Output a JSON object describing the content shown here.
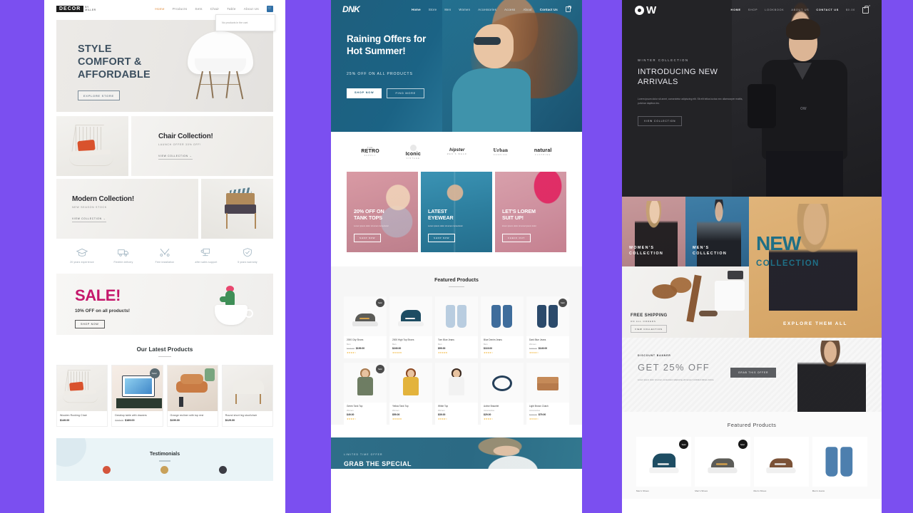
{
  "page": {
    "background_color": "#7b4ff0",
    "title": "Three e-commerce website mockups"
  },
  "site1": {
    "name": "DECOR",
    "logo": {
      "mark": "DECOR",
      "sub_line1": "BY",
      "sub_line2": "MILLER"
    },
    "nav": [
      {
        "label": "Home",
        "active": true
      },
      {
        "label": "Products",
        "active": false
      },
      {
        "label": "Sets",
        "active": false
      },
      {
        "label": "Chair",
        "active": false
      },
      {
        "label": "Table",
        "active": false
      },
      {
        "label": "About Us",
        "active": false
      }
    ],
    "cart_icon": "shopping-cart-icon",
    "cart_popup": "No products in the cart.",
    "hero": {
      "line1": "STYLE",
      "line2": "COMFORT &",
      "line3": "AFFORDABLE",
      "button": "EXPLORE STORE"
    },
    "collections": [
      {
        "title": "Chair Collection!",
        "sub": "LAUNCH OFFER 30% OFF!",
        "link": "VIEW COLLECTION  →"
      },
      {
        "title": "Modern Collection!",
        "sub": "NEW SEASON STOCK",
        "link": "VIEW COLLECTION  →"
      }
    ],
    "features": [
      {
        "icon": "graduation-cap-icon",
        "label": "20 years experience"
      },
      {
        "icon": "truck-icon",
        "label": "Flexible delivery"
      },
      {
        "icon": "tools-icon",
        "label": "Free installation"
      },
      {
        "icon": "support-icon",
        "label": "after sales support"
      },
      {
        "icon": "shield-check-icon",
        "label": "5 years warranty"
      }
    ],
    "sale": {
      "title": "SALE!",
      "sub": "10% OFF on all products!",
      "button": "SHOP NOW"
    },
    "latest": {
      "heading": "Our Latest Products",
      "products": [
        {
          "name": "Wooden Rocking Chair",
          "price": "$149.00",
          "old_price": "",
          "badge": ""
        },
        {
          "name": "Desktop table with drawers",
          "price": "$189.00",
          "old_price": "$349.00",
          "badge": "Sale!"
        },
        {
          "name": "Orange recliner with top rest",
          "price": "$199.00",
          "old_price": "",
          "badge": ""
        },
        {
          "name": "Round short leg stool/chair",
          "price": "$129.00",
          "old_price": "",
          "badge": ""
        }
      ]
    },
    "testimonials": {
      "heading": "Testimonials"
    }
  },
  "site2": {
    "name": "DNK",
    "nav": [
      {
        "label": "Home",
        "active": true
      },
      {
        "label": "Store",
        "active": false
      },
      {
        "label": "Men",
        "active": false
      },
      {
        "label": "Women",
        "active": false
      },
      {
        "label": "Accessories",
        "active": false
      },
      {
        "label": "Access",
        "active": false
      },
      {
        "label": "About",
        "active": false
      },
      {
        "label": "Contact Us",
        "active": true
      }
    ],
    "cart_icon": "shopping-bag-icon",
    "hero": {
      "line1": "Raining Offers for",
      "line2": "Hot Summer!",
      "sub": "25% OFF ON ALL PRODUCTS",
      "primary_button": "SHOP NOW",
      "secondary_button": "FIND MORE"
    },
    "brands": [
      {
        "top": "THE",
        "main": "RETRO",
        "bottom": "SUPPLY"
      },
      {
        "top": "",
        "main": "Iconic",
        "bottom": "VINTAGE"
      },
      {
        "top": "",
        "main": "hipster",
        "bottom": "MEN'S WEAR"
      },
      {
        "top": "",
        "main": "Urban",
        "bottom": "FASHION"
      },
      {
        "top": "",
        "main": "natural",
        "bottom": "CLOTHING"
      }
    ],
    "promos": [
      {
        "title": "20% OFF ON\nTANK TOPS",
        "desc": "Lorem ipsum dolor sit amet consectetur",
        "button": "SHOP NOW"
      },
      {
        "title": "LATEST\nEYEWEAR",
        "desc": "Lorem ipsum dolor sit amet consectetur",
        "button": "SHOP NOW"
      },
      {
        "title": "LET'S LOREM\nSUIT UP!",
        "desc": "lorem ipsum dolor sit amet ipsum dolor",
        "button": "CHECK OUT"
      }
    ],
    "featured": {
      "heading": "Featured Products",
      "row1": [
        {
          "name": "2000 City Shoes",
          "category": "Men",
          "price": "$199.00",
          "old_price": "$249.00",
          "stars": "★★★★☆",
          "badge": "Sale!",
          "glyph": "shoe"
        },
        {
          "name": "2000 High Top Shoes",
          "category": "Men",
          "price": "$249.00",
          "old_price": "",
          "stars": "★★★★★",
          "badge": "",
          "glyph": "shoe"
        },
        {
          "name": "Torn Blue Jeans",
          "category": "Men",
          "price": "$99.00",
          "old_price": "",
          "stars": "★★★★★",
          "badge": "",
          "glyph": "jeans"
        },
        {
          "name": "Blue Denim Jeans",
          "category": "Men",
          "price": "$119.00",
          "old_price": "",
          "stars": "★★★★☆",
          "badge": "",
          "glyph": "jeans"
        },
        {
          "name": "Dark Blue Jeans",
          "category": "Women",
          "price": "$149.00",
          "old_price": "$199.00",
          "stars": "★★★★☆",
          "badge": "Sale!",
          "glyph": "jeans"
        }
      ],
      "row2": [
        {
          "name": "Green Tank Top",
          "category": "Women",
          "price": "$49.00",
          "old_price": "",
          "stars": "★★★★☆",
          "badge": "Sale!",
          "glyph": "person"
        },
        {
          "name": "Yellow Tank Top",
          "category": "Women",
          "price": "$59.00",
          "old_price": "",
          "stars": "★★★★★",
          "badge": "",
          "glyph": "person"
        },
        {
          "name": "White Top",
          "category": "Women",
          "price": "$39.00",
          "old_price": "",
          "stars": "★★★★☆",
          "badge": "",
          "glyph": "person"
        },
        {
          "name": "Active Bracelet",
          "category": "Accessories",
          "price": "$29.00",
          "old_price": "",
          "stars": "★★★★☆",
          "badge": "",
          "glyph": "belt"
        },
        {
          "name": "Light Brown Clutch",
          "category": "Accessories",
          "price": "$79.00",
          "old_price": "$109.00",
          "stars": "★★★★☆",
          "badge": "",
          "glyph": "purse"
        }
      ]
    },
    "bottom_banner": {
      "kicker": "LIMITED TIME OFFER",
      "title": "GRAB THE SPECIAL"
    }
  },
  "site3": {
    "name": "OW",
    "nav": [
      {
        "label": "HOME",
        "active": true
      },
      {
        "label": "SHOP",
        "active": false
      },
      {
        "label": "LOOKBOOK",
        "active": false
      },
      {
        "label": "ABOUT US",
        "active": false
      },
      {
        "label": "CONTACT US",
        "active": true
      }
    ],
    "cart_label": "$0.00",
    "cart_icon": "shopping-bag-icon",
    "cart_count": "0",
    "hero": {
      "kicker": "WINTER COLLECTION",
      "line1": "INTRODUCING NEW",
      "line2": "ARRIVALS",
      "body": "Lorem ipsum dolor sit amet, consectetur adipiscing elit. Sit elit tellus luctus nec ullamcorper mattis, pulvinar dapibus leo.",
      "button": "VIEW COLLECTION"
    },
    "tiles": [
      {
        "caption_line1": "WOMEN'S",
        "caption_line2": "COLLECTION"
      },
      {
        "caption_line1": "MEN'S",
        "caption_line2": "COLLECTION"
      }
    ],
    "shipping": {
      "title": "FREE SHIPPING",
      "sub": "ON ALL ORDERS",
      "button": "VIEW COLLECTION"
    },
    "new_collection": {
      "line1": "NEW",
      "line2": "COLLECTION",
      "cta": "EXPLORE THEM ALL"
    },
    "discount": {
      "kicker": "DISCOUNT BANNER",
      "title": "GET 25% OFF",
      "body": "Lorem ipsum dolor sit amet, consectetur adipiscing elit tempor incididunt labore dolore.",
      "button": "GRAB THIS OFFER"
    },
    "featured": {
      "heading": "Featured Products",
      "products": [
        {
          "name": "Men's Shoes",
          "badge": "Sale!",
          "glyph": "shoe"
        },
        {
          "name": "Men's Shoes",
          "badge": "Sale!",
          "glyph": "shoe"
        },
        {
          "name": "Men's Shoes",
          "badge": "",
          "glyph": "shoe"
        },
        {
          "name": "Men's Jeans",
          "badge": "",
          "glyph": "jeans"
        }
      ]
    }
  }
}
